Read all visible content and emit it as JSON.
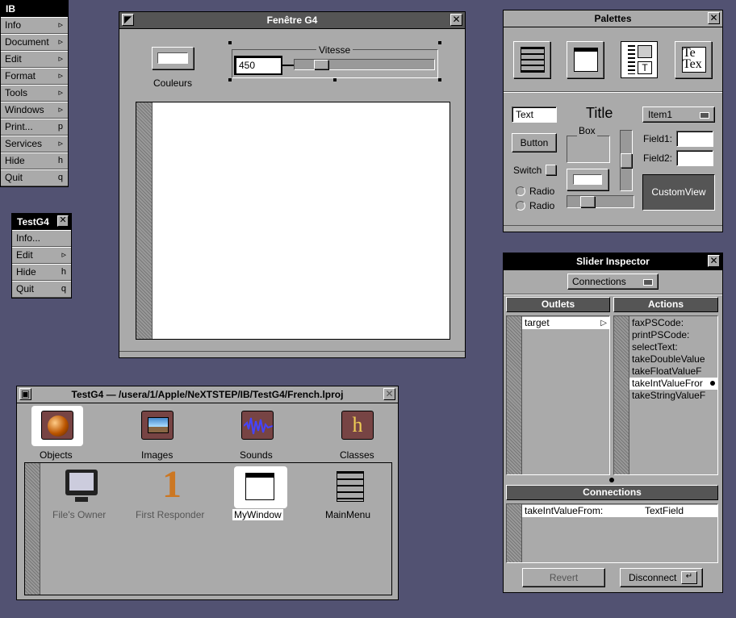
{
  "app_menu": {
    "title": "IB",
    "items": [
      {
        "label": "Info",
        "key": "▹"
      },
      {
        "label": "Document",
        "key": "▹"
      },
      {
        "label": "Edit",
        "key": "▹"
      },
      {
        "label": "Format",
        "key": "▹"
      },
      {
        "label": "Tools",
        "key": "▹"
      },
      {
        "label": "Windows",
        "key": "▹"
      },
      {
        "label": "Print...",
        "key": "p"
      },
      {
        "label": "Services",
        "key": "▹"
      },
      {
        "label": "Hide",
        "key": "h"
      },
      {
        "label": "Quit",
        "key": "q"
      }
    ]
  },
  "test_menu": {
    "title": "TestG4",
    "items": [
      {
        "label": "Info...",
        "key": ""
      },
      {
        "label": "Edit",
        "key": "▹"
      },
      {
        "label": "Hide",
        "key": "h"
      },
      {
        "label": "Quit",
        "key": "q"
      }
    ]
  },
  "g4_window": {
    "title": "Fenêtre G4",
    "color_label": "Couleurs",
    "slider_box_title": "Vitesse",
    "speed_value": "450"
  },
  "palettes": {
    "title": "Palettes",
    "text_field": "Text",
    "title_label": "Title",
    "popup_item": "Item1",
    "box_label": "Box",
    "button_label": "Button",
    "switch_label": "Switch",
    "radio1": "Radio",
    "radio2": "Radio",
    "field1_label": "Field1:",
    "field2_label": "Field2:",
    "custom_view": "CustomView"
  },
  "inspector": {
    "title": "Slider Inspector",
    "mode": "Connections",
    "outlets_header": "Outlets",
    "actions_header": "Actions",
    "outlets": [
      "target"
    ],
    "actions": [
      "faxPSCode:",
      "printPSCode:",
      "selectText:",
      "takeDoubleValue",
      "takeFloatValueF",
      "takeIntValueFror",
      "takeStringValueF"
    ],
    "connections_header": "Connections",
    "connection_action": "takeIntValueFrom:",
    "connection_target": "TextField",
    "revert": "Revert",
    "disconnect": "Disconnect"
  },
  "project": {
    "title": "TestG4 — /usera/1/Apple/NeXTSTEP/IB/TestG4/French.lproj",
    "tabs": [
      "Objects",
      "Images",
      "Sounds",
      "Classes"
    ],
    "objects": [
      "File's Owner",
      "First Responder",
      "MyWindow",
      "MainMenu"
    ]
  }
}
